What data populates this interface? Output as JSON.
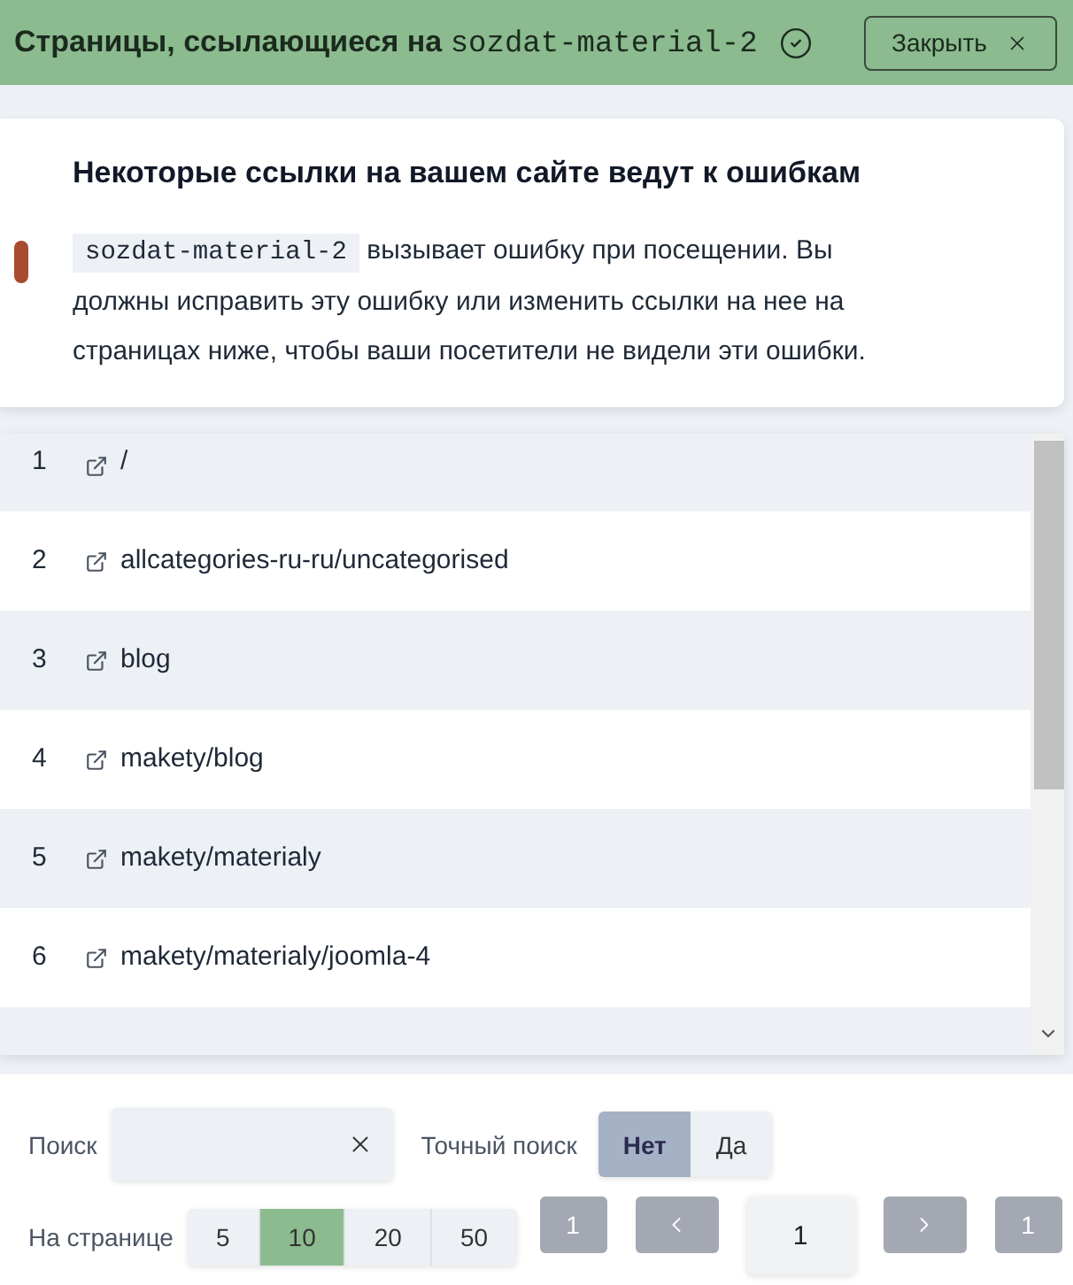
{
  "header": {
    "title": "Страницы, ссылающиеся на",
    "title_code": "sozdat-material-2",
    "close_label": "Закрыть"
  },
  "notice": {
    "heading": "Некоторые ссылки на вашем сайте ведут к ошибкам",
    "code": "sozdat-material-2",
    "text": "вызывает ошибку при посещении. Вы должны исправить эту ошибку или изменить ссылки на нее на страницах ниже, чтобы ваши посетители не видели эти ошибки."
  },
  "rows": [
    {
      "number": "1",
      "path": "/"
    },
    {
      "number": "2",
      "path": "allcategories-ru-ru/uncategorised"
    },
    {
      "number": "3",
      "path": "blog"
    },
    {
      "number": "4",
      "path": "makety/blog"
    },
    {
      "number": "5",
      "path": "makety/materialy"
    },
    {
      "number": "6",
      "path": "makety/materialy/joomla-4"
    }
  ],
  "search": {
    "label": "Поиск"
  },
  "exact_search": {
    "label": "Точный поиск",
    "options": [
      {
        "label": "Нет",
        "selected": true
      },
      {
        "label": "Да",
        "selected": false
      }
    ]
  },
  "per_page": {
    "label": "На странице",
    "options": [
      {
        "label": "5",
        "selected": false
      },
      {
        "label": "10",
        "selected": true
      },
      {
        "label": "20",
        "selected": false
      },
      {
        "label": "50",
        "selected": false
      }
    ]
  },
  "pagination": [
    {
      "kind": "first",
      "label": "1",
      "disabled": true
    },
    {
      "kind": "prev",
      "disabled": true
    },
    {
      "kind": "page",
      "value": "1"
    },
    {
      "kind": "next",
      "disabled": true
    },
    {
      "kind": "last",
      "label": "1",
      "disabled": true
    }
  ]
}
